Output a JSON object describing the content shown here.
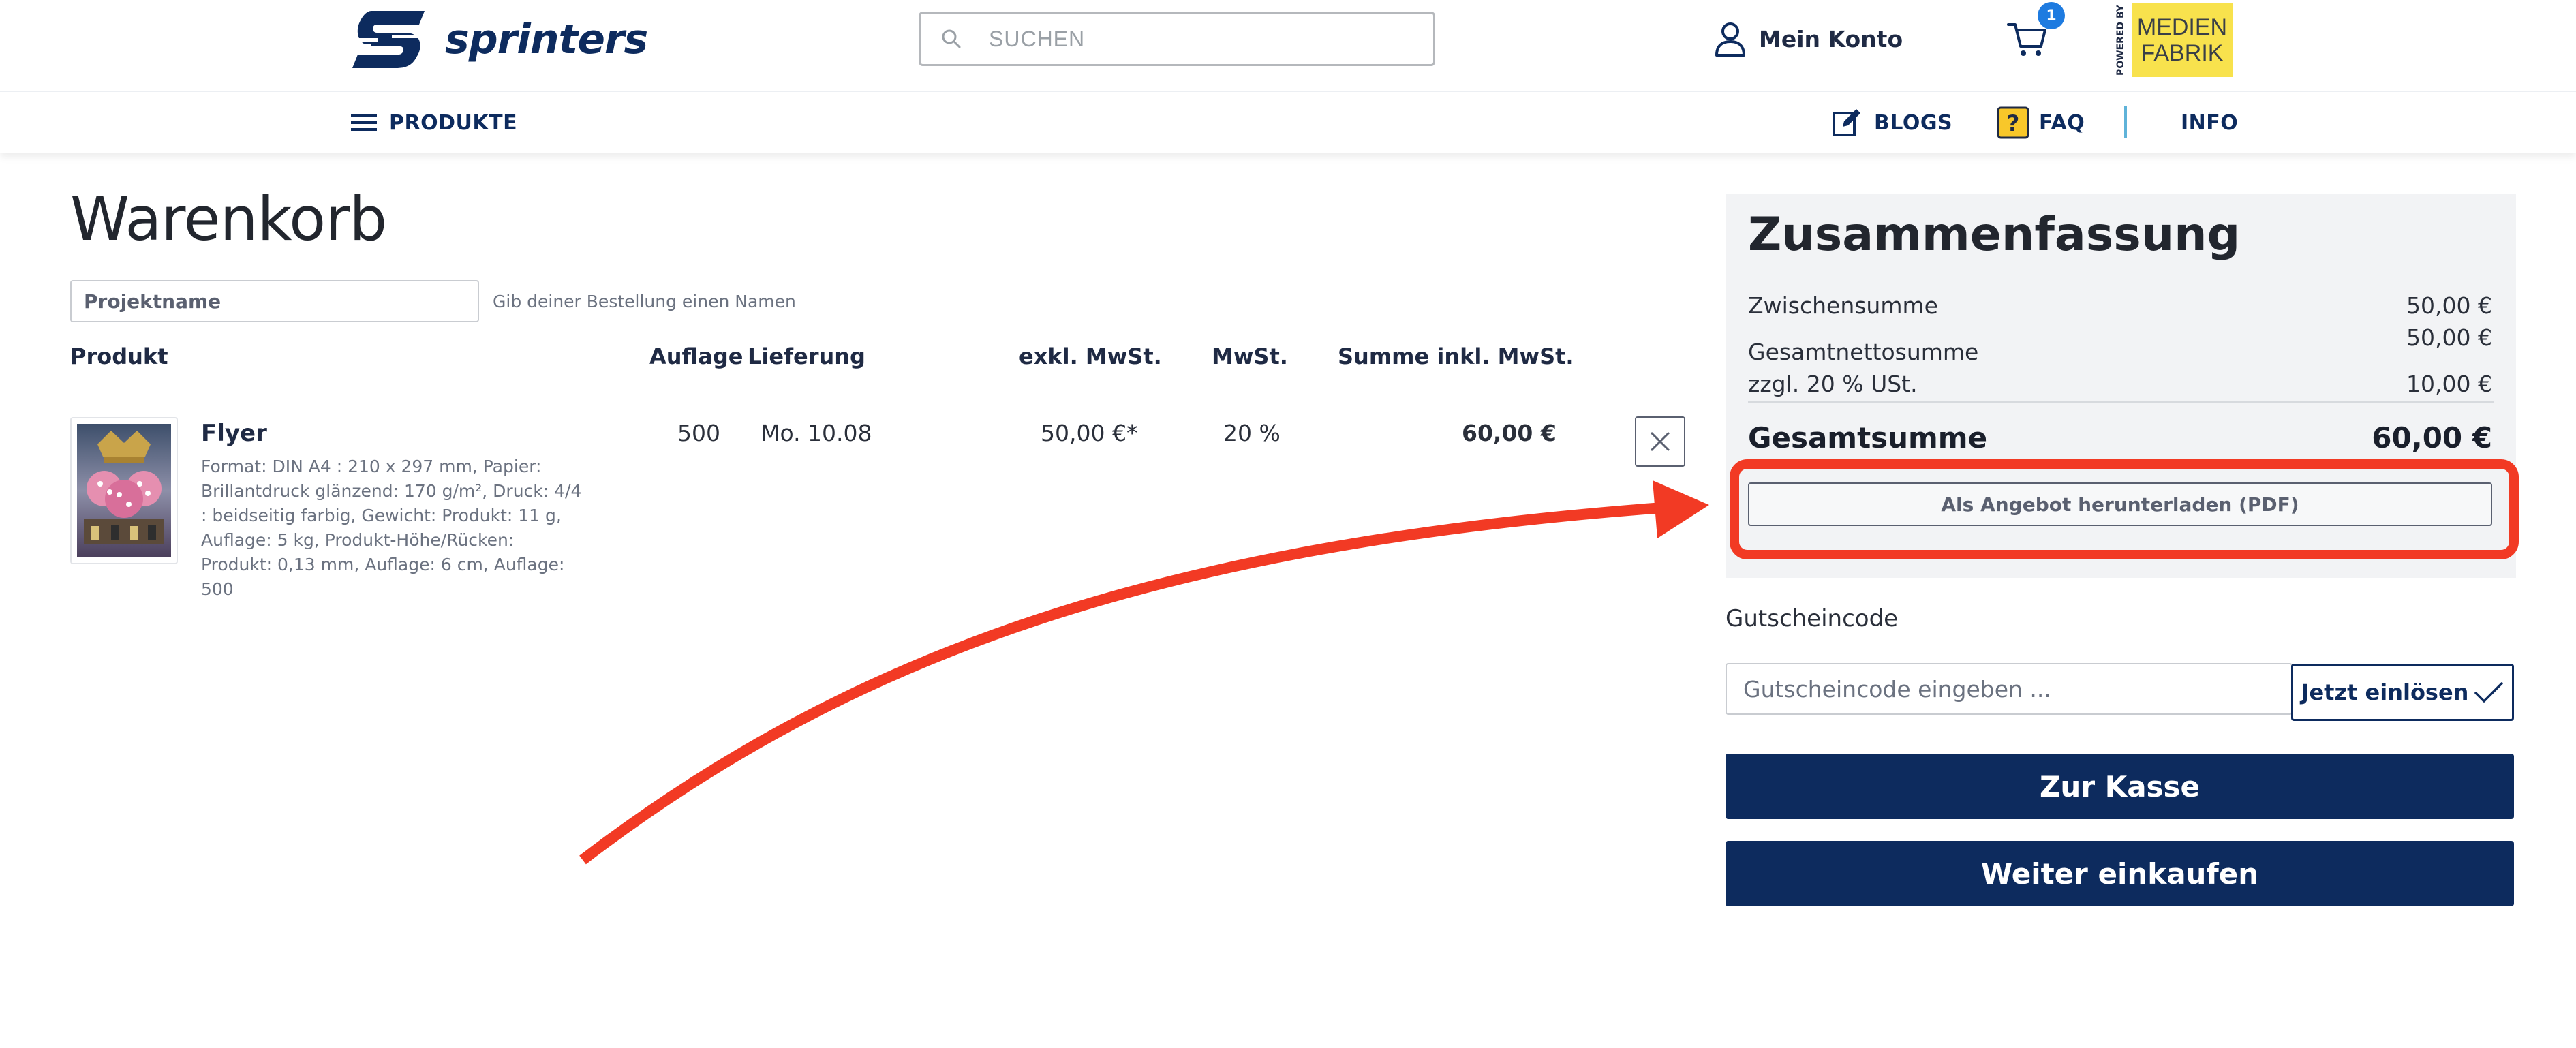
{
  "header": {
    "logo_text": "sprinters",
    "search_placeholder": "SUCHEN",
    "account_label": "Mein Konto",
    "cart_count": "1",
    "powered_by": "POWERED BY",
    "partner_line1": "MEDIEN",
    "partner_line2": "FABRIK"
  },
  "nav": {
    "produkte": "PRODUKTE",
    "blogs": "BLOGS",
    "faq": "FAQ",
    "info": "INFO"
  },
  "cart": {
    "title": "Warenkorb",
    "project_placeholder": "Projektname",
    "project_hint": "Gib deiner Bestellung einen Namen",
    "columns": {
      "product": "Produkt",
      "auflage": "Auflage",
      "lieferung": "Lieferung",
      "exkl": "exkl. MwSt.",
      "mwst": "MwSt.",
      "summe": "Summe inkl. MwSt."
    },
    "items": [
      {
        "name": "Flyer",
        "description": "Format: DIN A4 : 210 x 297 mm, Papier: Brillantdruck glänzend: 170 g/m², Druck: 4/4 : beidseitig farbig, Gewicht: Produkt: 11 g, Auflage: 5 kg, Produkt-Höhe/Rücken: Produkt: 0,13 mm, Auflage: 6 cm, Auflage: 500",
        "auflage": "500",
        "lieferung": "Mo. 10.08",
        "exkl": "50,00 €*",
        "mwst": "20 %",
        "summe": "60,00 €"
      }
    ]
  },
  "summary": {
    "title": "Zusammenfassung",
    "zwischensumme_label": "Zwischensumme",
    "zwischensumme_value": "50,00 €",
    "netto_label": "Gesamtnettosumme",
    "netto_value": "50,00 €",
    "ust_label": "zzgl. 20 % USt.",
    "ust_value": "10,00 €",
    "total_label": "Gesamtsumme",
    "total_value": "60,00 €",
    "pdf_button": "Als Angebot herunterladen (PDF)"
  },
  "coupon": {
    "label": "Gutscheincode",
    "placeholder": "Gutscheincode eingeben ...",
    "button": "Jetzt einlösen"
  },
  "actions": {
    "checkout": "Zur Kasse",
    "continue": "Weiter einkaufen"
  },
  "colors": {
    "brand": "#0d2b5e",
    "badge": "#1e7be0",
    "highlight": "#f23a24",
    "partner_bg": "#f8e24d"
  }
}
